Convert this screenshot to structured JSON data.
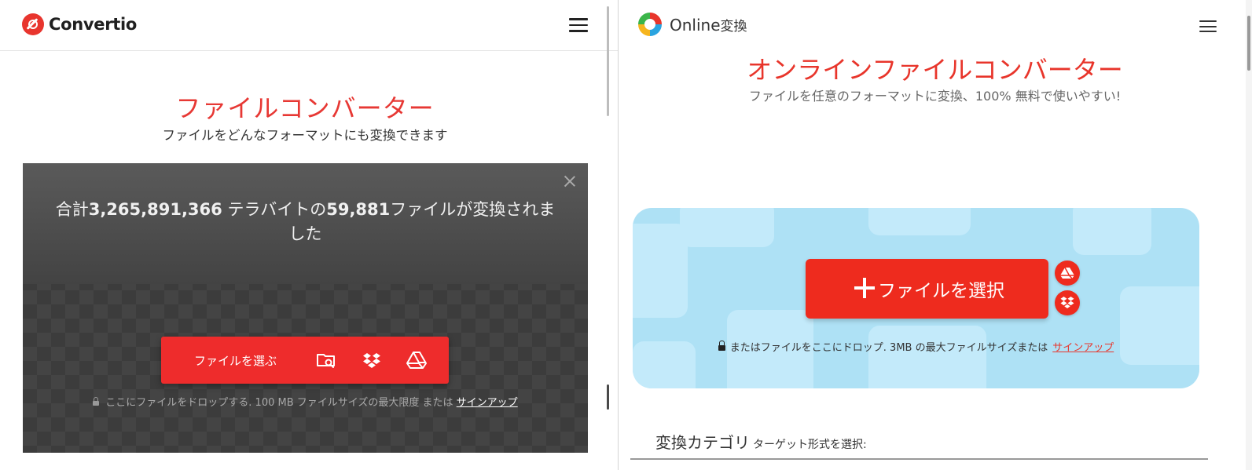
{
  "left": {
    "brand": "Convertio",
    "title": "ファイルコンバーター",
    "subtitle": "ファイルをどんなフォーマットにも変換できます",
    "stats": {
      "prefix": "合計",
      "total_size": "3,265,891,366",
      "size_unit": " テラバイトの",
      "file_count": "59,881",
      "suffix": "ファイルが変換されました"
    },
    "choose_button": "ファイルを選ぶ",
    "footnote": "ここにファイルをドロップする. 100 MB ファイルサイズの最大限度 または",
    "signup": "サインアップ",
    "icons": [
      "folder-search-icon",
      "dropbox-icon",
      "google-drive-icon"
    ]
  },
  "right": {
    "brand_latin": "Online",
    "brand_jp": "変換",
    "title": "オンラインファイルコンバーター",
    "subtitle": "ファイルを任意のフォーマットに変換、100% 無料で使いやすい!",
    "select_button": "ファイルを選択",
    "note": "またはファイルをここにドロップ. 3MB の最大ファイルサイズまたは",
    "signup": "サインアップ",
    "category_title": "変換カテゴリ",
    "category_sub": "ターゲット形式を選択:",
    "colors": {
      "accent": "#ee2b1e",
      "drop_bg": "#aee1f5"
    }
  }
}
